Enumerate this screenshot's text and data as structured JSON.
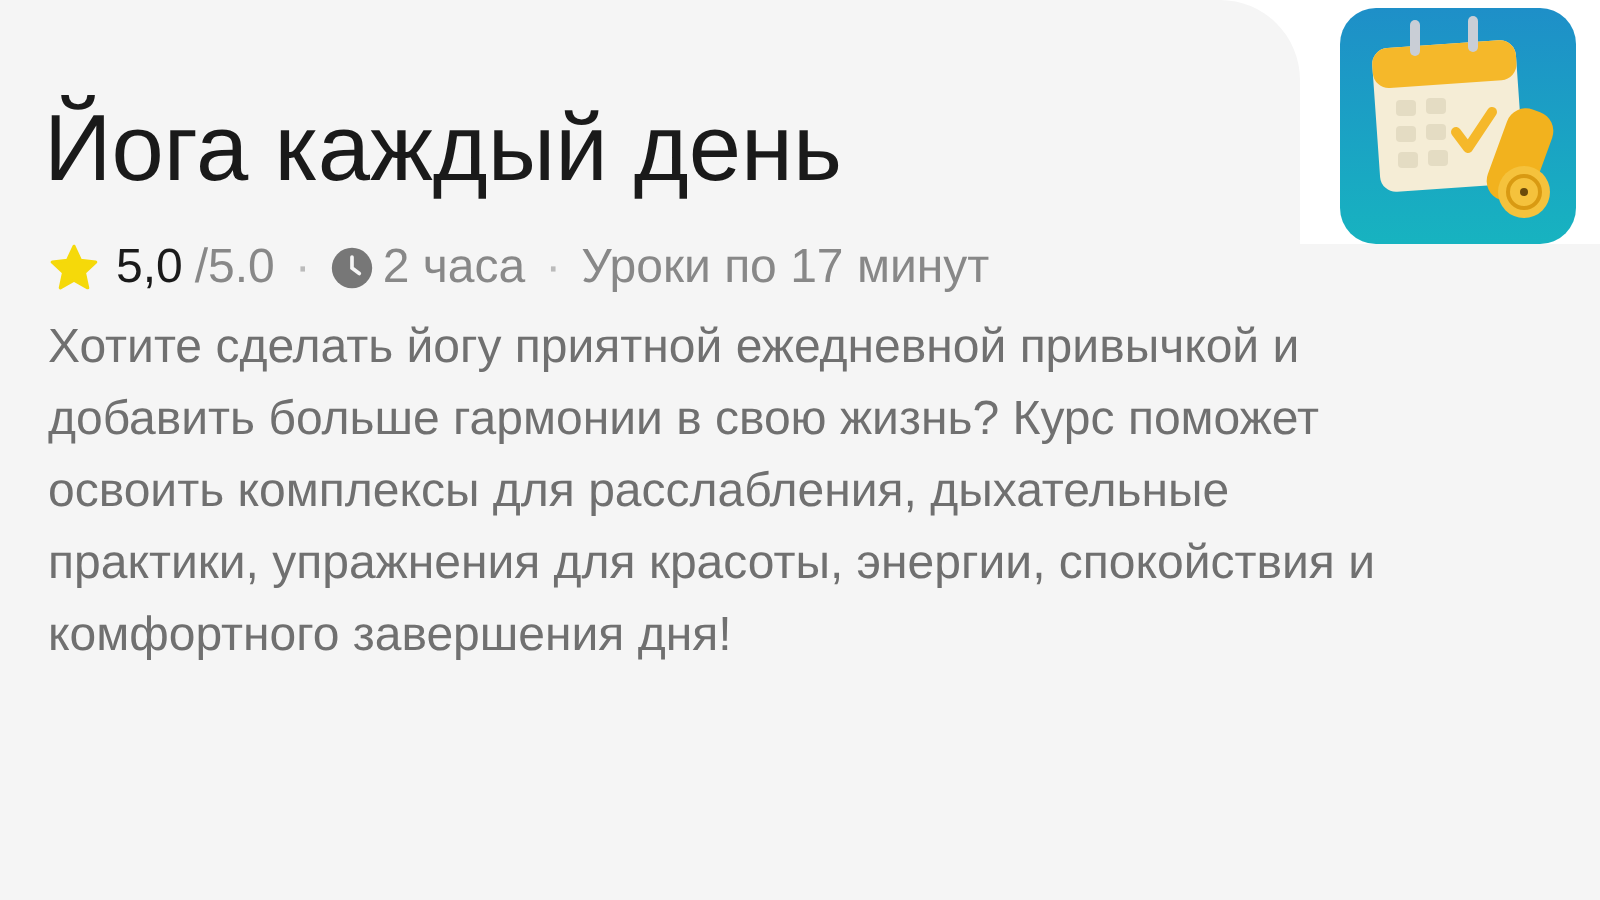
{
  "course": {
    "title": "Йога каждый день",
    "rating": "5,0",
    "rating_max": "/5.0",
    "duration": "2 часа",
    "lessons": "Уроки по 17 минут",
    "description": "Хотите сделать йогу приятной ежедневной привычкой и добавить больше гармонии в свою жизнь? Курс поможет освоить комплексы для расслабления, дыхательные практики, упражнения для красоты, энергии, спокойствия и комфортного завершения дня!",
    "separator": "·"
  }
}
